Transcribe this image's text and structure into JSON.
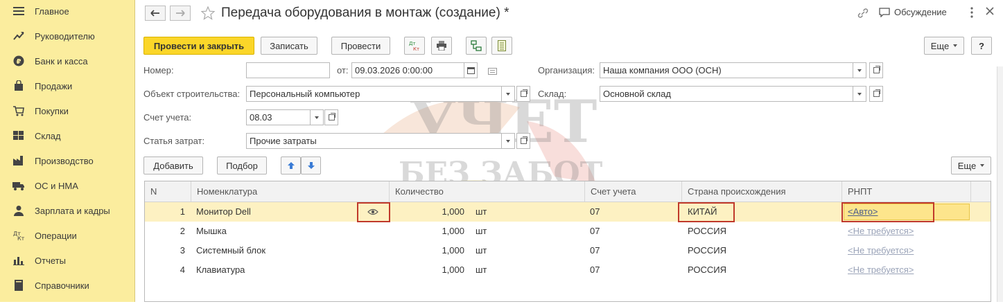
{
  "sidebar": {
    "items": [
      {
        "label": "Главное",
        "icon": "menu-icon"
      },
      {
        "label": "Руководителю",
        "icon": "trend-icon"
      },
      {
        "label": "Банк и касса",
        "icon": "ruble-icon"
      },
      {
        "label": "Продажи",
        "icon": "bag-icon"
      },
      {
        "label": "Покупки",
        "icon": "cart-icon"
      },
      {
        "label": "Склад",
        "icon": "warehouse-icon"
      },
      {
        "label": "Производство",
        "icon": "factory-icon"
      },
      {
        "label": "ОС и НМА",
        "icon": "truck-icon"
      },
      {
        "label": "Зарплата и кадры",
        "icon": "person-icon"
      },
      {
        "label": "Операции",
        "icon": "dt-kt-icon"
      },
      {
        "label": "Отчеты",
        "icon": "bar-chart-icon"
      },
      {
        "label": "Справочники",
        "icon": "book-icon"
      }
    ]
  },
  "header": {
    "title": "Передача оборудования в монтаж (создание) *",
    "discussion": "Обсуждение"
  },
  "toolbar": {
    "post_close": "Провести и закрыть",
    "save": "Записать",
    "post": "Провести",
    "more": "Еще",
    "help": "?"
  },
  "form": {
    "number_label": "Номер:",
    "number_value": "",
    "date_label": "от:",
    "date_value": "09.03.2026  0:00:00",
    "org_label": "Организация:",
    "org_value": "Наша компания ООО (ОСН)",
    "object_label": "Объект строительства:",
    "object_value": "Персональный компьютер",
    "warehouse_label": "Склад:",
    "warehouse_value": "Основной склад",
    "account_label": "Счет учета:",
    "account_value": "08.03",
    "cost_label": "Статья затрат:",
    "cost_value": "Прочие затраты"
  },
  "table_toolbar": {
    "add": "Добавить",
    "pick": "Подбор",
    "more": "Еще"
  },
  "table": {
    "headers": [
      "N",
      "Номенклатура",
      "Количество",
      "Счет учета",
      "Страна происхождения",
      "РНПТ"
    ],
    "rows": [
      {
        "n": "1",
        "item": "Монитор Dell",
        "qty": "1,000",
        "unit": "шт",
        "account": "07",
        "country": "КИТАЙ",
        "rnpt": "<Авто>"
      },
      {
        "n": "2",
        "item": "Мышка",
        "qty": "1,000",
        "unit": "шт",
        "account": "07",
        "country": "РОССИЯ",
        "rnpt": "<Не требуется>"
      },
      {
        "n": "3",
        "item": "Системный блок",
        "qty": "1,000",
        "unit": "шт",
        "account": "07",
        "country": "РОССИЯ",
        "rnpt": "<Не требуется>"
      },
      {
        "n": "4",
        "item": "Клавиатура",
        "qty": "1,000",
        "unit": "шт",
        "account": "07",
        "country": "РОССИЯ",
        "rnpt": "<Не требуется>"
      }
    ]
  },
  "watermark": {
    "line1": "УЧЕТ",
    "line2": "БЕЗ ЗАБОТ"
  },
  "colors": {
    "sidebar_bg": "#fbed9e",
    "primary_button": "#fbd629",
    "selected_row": "#fdf1c2",
    "highlight_box": "#c0392b"
  }
}
